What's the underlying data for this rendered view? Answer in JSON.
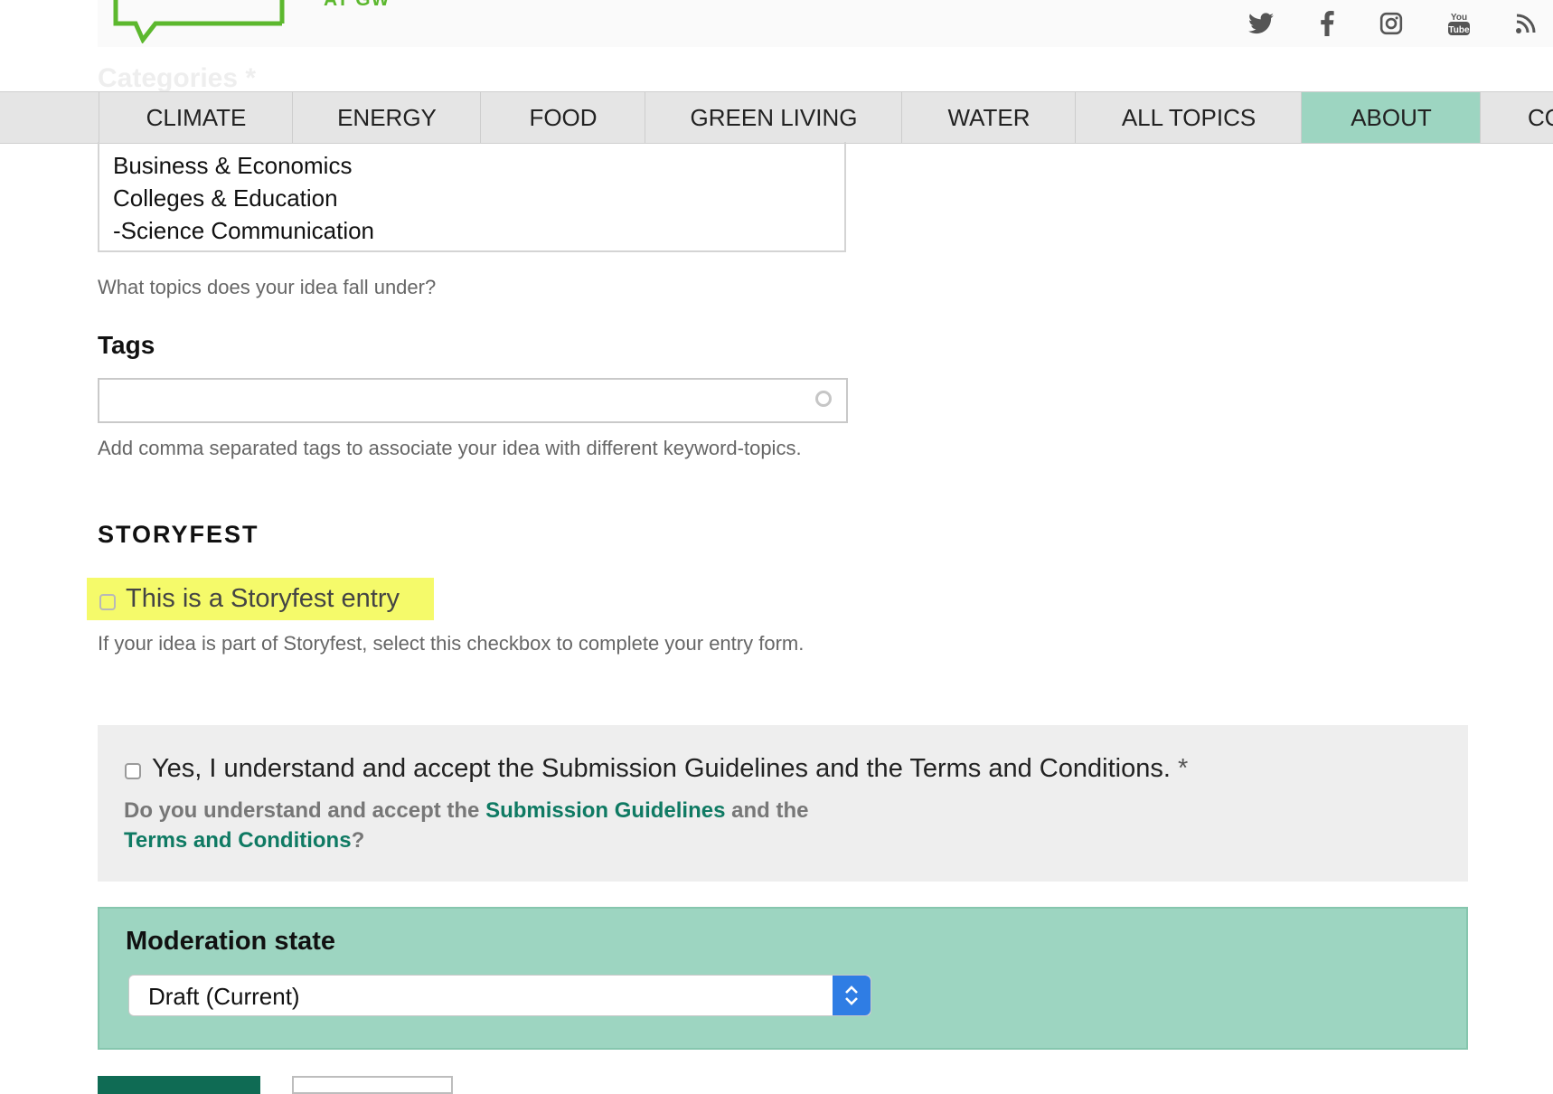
{
  "header": {
    "logo_text": "AT GW",
    "social_icons": [
      "twitter-icon",
      "facebook-icon",
      "instagram-icon",
      "youtube-icon",
      "rss-icon"
    ]
  },
  "faded_label": "Categories *",
  "nav": {
    "items": [
      {
        "label": "CLIMATE"
      },
      {
        "label": "ENERGY"
      },
      {
        "label": "FOOD"
      },
      {
        "label": "GREEN LIVING"
      },
      {
        "label": "WATER"
      },
      {
        "label": "ALL TOPICS"
      },
      {
        "label": "ABOUT"
      },
      {
        "label": "CO"
      }
    ],
    "active": "ABOUT"
  },
  "categories": {
    "options": [
      "Business & Economics",
      "Colleges & Education",
      "-Science Communication"
    ],
    "help": "What topics does your idea fall under?"
  },
  "tags": {
    "label": "Tags",
    "value": "",
    "help": "Add comma separated tags to associate your idea with different keyword-topics."
  },
  "storyfest": {
    "heading": "STORYFEST",
    "checkbox_label": "This is a Storyfest entry",
    "checked": false,
    "help": "If your idea is part of Storyfest, select this checkbox to complete your entry form."
  },
  "terms": {
    "checkbox_label": "Yes, I understand and accept the Submission Guidelines and the Terms and Conditions.",
    "required_mark": "*",
    "checked": false,
    "help_prefix": "Do you understand and accept the ",
    "link1": "Submission Guidelines",
    "help_mid": " and the ",
    "link2": "Terms and Conditions",
    "help_suffix": "?"
  },
  "moderation": {
    "label": "Moderation state",
    "selected": "Draft (Current)"
  },
  "colors": {
    "accent": "#9dd5c1",
    "link": "#0f7a63",
    "highlight": "#f5fa6a",
    "primary_button": "#0f6b54"
  }
}
